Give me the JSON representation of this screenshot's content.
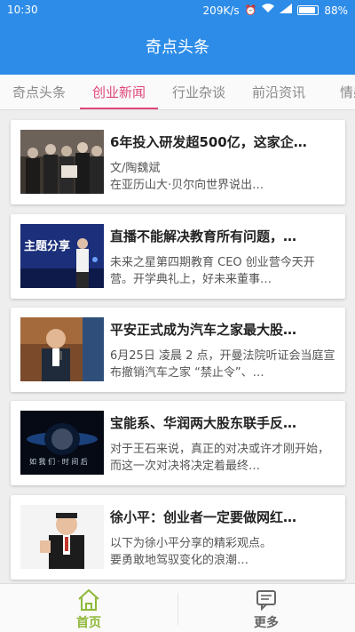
{
  "status_bar": {
    "time": "10:30",
    "network_speed": "209K/s",
    "battery_percent_label": "88%",
    "battery_level": 0.88
  },
  "app": {
    "title": "奇点头条",
    "primary_color": "#2d8ce8",
    "accent_color": "#e0457b"
  },
  "tabs": [
    {
      "label": "奇点头条",
      "active": false
    },
    {
      "label": "创业新闻",
      "active": true
    },
    {
      "label": "行业杂谈",
      "active": false
    },
    {
      "label": "前沿资讯",
      "active": false
    },
    {
      "label": "情感",
      "active": false
    }
  ],
  "articles": [
    {
      "title": "6年投入研发超500亿，这家企…",
      "summary": "文/陶魏斌\n在亚历山大·贝尔向世界说出…"
    },
    {
      "title": "直播不能解决教育所有问题，…",
      "summary": "未来之星第四期教育 CEO 创业营今天开营。开学典礼上，好未来董事…",
      "image_text": "主题分享"
    },
    {
      "title": "平安正式成为汽车之家最大股…",
      "summary": "6月25日 凌晨 2 点，开曼法院听证会当庭宣布撤销汽车之家 “禁止令”、…"
    },
    {
      "title": "宝能系、华润两大股东联手反…",
      "summary": "对于王石来说，真正的对决或许才刚开始，而这一次对决将决定着最终…"
    },
    {
      "title": "徐小平：创业者一定要做网红…",
      "summary": "以下为徐小平分享的精彩观点。\n要勇敢地驾驭变化的浪潮…"
    }
  ],
  "bottom_nav": [
    {
      "label": "首页",
      "icon": "home-icon",
      "active": true,
      "color": "#8fb83a"
    },
    {
      "label": "更多",
      "icon": "message-icon",
      "active": false,
      "color": "#666666"
    }
  ]
}
